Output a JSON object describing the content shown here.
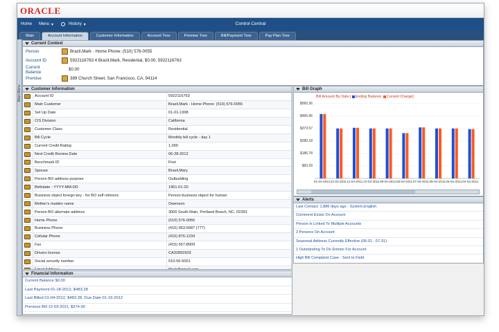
{
  "app": {
    "brand": "ORACLE",
    "title": "Control Central"
  },
  "topnav": {
    "home": "Home",
    "menu": "Menu",
    "history": "History"
  },
  "tabs": [
    "Main",
    "Account Information",
    "Customer Information",
    "Account Tree",
    "Premise Tree",
    "Bill/Payment Tree",
    "Pay Plan Tree"
  ],
  "active_tab": "Account Information",
  "side_menu_label": "Main Menu",
  "current_context": {
    "title": "Current Context",
    "rows": [
      {
        "label": "Person",
        "value": "Brazil,Mark - Home Phone: (510) 576-0055"
      },
      {
        "label": "Account ID",
        "value": "5922116763 4 Brazil,Mark, Residental, $0.00, 5922116763"
      },
      {
        "label": "Current Balance",
        "value": "$0.00"
      },
      {
        "label": "Premise",
        "value": "389 Church Street, San Francisco, CA, 94114"
      }
    ]
  },
  "customer_information": {
    "title": "Customer Information",
    "rows": [
      [
        "Account ID",
        "5922116763"
      ],
      [
        "Main Customer",
        "Brazil,Mark - Home Phone: (510) 576-0055"
      ],
      [
        "Set Up Date",
        "01-01-1998"
      ],
      [
        "CIS Division",
        "California"
      ],
      [
        "Customer Class",
        "Residential"
      ],
      [
        "Bill Cycle",
        "Monthly bill cycle - day 1"
      ],
      [
        "Current Credit Rating",
        "1,000"
      ],
      [
        "Next Credit Review Date",
        "06-28-2012"
      ],
      [
        "Benchmark ID",
        "First"
      ],
      [
        "Spouse",
        "Brazil,Mary"
      ],
      [
        "Person BO address purpose",
        "Outbuilding"
      ],
      [
        "Birthdate - YYYY-MM-DD",
        "1961-01-20"
      ],
      [
        "Business object foreign key - for BO self referenc",
        "Person business object for human"
      ],
      [
        "Mother's maiden name",
        "Owenson"
      ],
      [
        "Person BO alternate address",
        "3000 South Main, Portland Beach, NC, 02393"
      ],
      [
        "Home Phone",
        "(510) 576-0055"
      ],
      [
        "Business Phone",
        "(415) 963-5687 (777)"
      ],
      [
        "Cellular Phone",
        "(415) 876-1234"
      ],
      [
        "Fax",
        "(415) 567-8909"
      ],
      [
        "Drivers license",
        "CA32892929"
      ],
      [
        "Social security number",
        "510-55-5001"
      ],
      [
        "Email Address",
        "Mark@gmail.com"
      ]
    ]
  },
  "financial_information": {
    "title": "Financial Information",
    "rows": [
      "Current Balance $0.00",
      "Last Payment 01-18-2012, $483.28",
      "Last Billed 01-04-2012, $483.28, Due Date 01-19-2012",
      "Previous Bill 12-03-2011, $374.90"
    ]
  },
  "bill_graph": {
    "title": "Bill Graph",
    "colors": {
      "ending_balance": "#1f4fd8",
      "current_charge": "#ff5a1f"
    }
  },
  "chart_data": {
    "type": "bar",
    "title": "Bill Amount By Date",
    "series": [
      {
        "name": "Ending Balance",
        "values": [
          483,
          375,
          380,
          375,
          375,
          340,
          383,
          375,
          375,
          370
        ]
      },
      {
        "name": "Current Charge",
        "values": [
          483,
          375,
          380,
          375,
          375,
          340,
          383,
          375,
          375,
          370
        ]
      }
    ],
    "categories": [
      "01-04-2012",
      "12-03-2011",
      "11-04-2011",
      "10-03-2011",
      "09-04-2011",
      "08-03-2011",
      "07-03-2011",
      "06-04-2011",
      "05-02-2011",
      "04-03-2011"
    ],
    "yticks": [
      "$93.39",
      "$186.78",
      "$280.18",
      "$373.57",
      "$466.96",
      "$560.36"
    ],
    "ylim": [
      0,
      560.36
    ],
    "legend": "top"
  },
  "alerts": {
    "title": "Alerts",
    "items": [
      "Last Contact: 1,886 days ago - System,English",
      "Comment Exists On Account",
      "Person Is Linked To Multiple Accounts",
      "2 Persons On Account",
      "Seasonal Address Currently Effective (06-01 - 07-31)",
      "1 Outstanding To Do Entries For Account",
      "High Bill Complaint Case - Sent to Field"
    ]
  }
}
